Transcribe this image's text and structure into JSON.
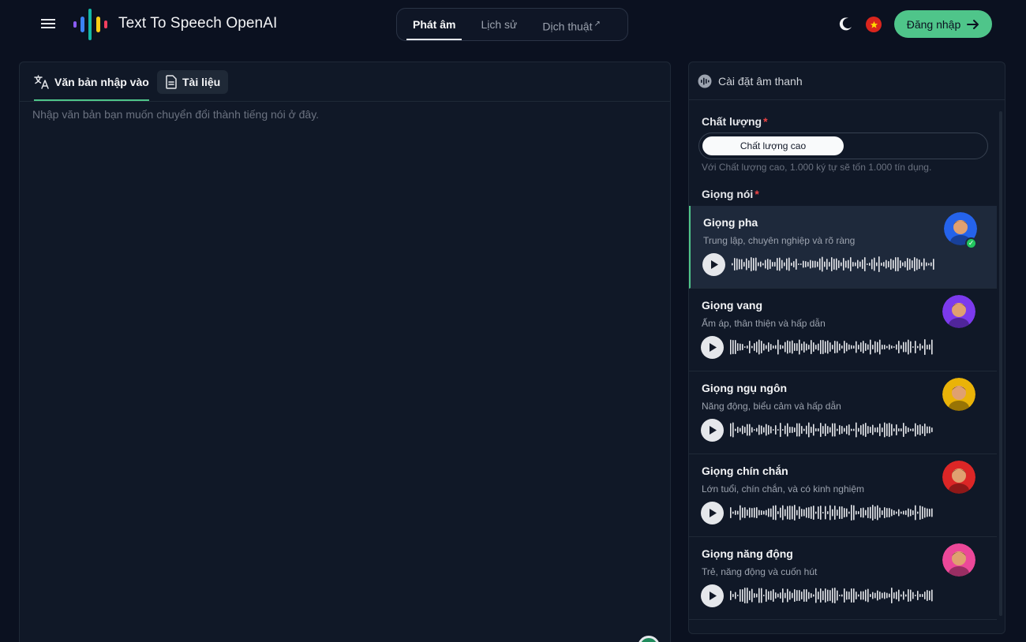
{
  "header": {
    "title": "Text To Speech OpenAI",
    "nav": [
      {
        "label": "Phát âm",
        "active": true
      },
      {
        "label": "Lịch sử",
        "active": false
      },
      {
        "label": "Dịch thuật",
        "active": false,
        "external": true
      }
    ],
    "login_label": "Đăng nhập",
    "icons": {
      "menu": "menu-icon",
      "theme": "moon-icon",
      "language": "vietnam-flag-icon",
      "login_arrow": "arrow-right-icon"
    }
  },
  "editor": {
    "tabs": [
      {
        "label": "Văn bản nhập vào",
        "icon": "translate-icon",
        "active": true
      },
      {
        "label": "Tài liệu",
        "icon": "document-icon",
        "active": false
      }
    ],
    "placeholder": "Nhập văn bản bạn muốn chuyển đổi thành tiếng nói ở đây."
  },
  "settings": {
    "title": "Cài đặt âm thanh",
    "quality_label": "Chất lượng",
    "quality_option": "Chất lượng cao",
    "quality_note": "Với Chất lượng cao, 1.000 ký tự sẽ tốn 1.000 tín dụng.",
    "voice_label": "Giọng nói",
    "voices": [
      {
        "name": "Giọng pha",
        "desc": "Trung lập, chuyên nghiệp và rõ ràng",
        "selected": true,
        "avatar_color": "#2563eb"
      },
      {
        "name": "Giọng vang",
        "desc": "Ấm áp, thân thiện và hấp dẫn",
        "selected": false,
        "avatar_color": "#7c3aed"
      },
      {
        "name": "Giọng ngụ ngôn",
        "desc": "Năng động, biểu cảm và hấp dẫn",
        "selected": false,
        "avatar_color": "#eab308"
      },
      {
        "name": "Giọng chín chắn",
        "desc": "Lớn tuổi, chín chắn, và có kinh nghiệm",
        "selected": false,
        "avatar_color": "#dc2626"
      },
      {
        "name": "Giọng năng động",
        "desc": "Trẻ, năng động và cuốn hút",
        "selected": false,
        "avatar_color": "#ec4899"
      }
    ]
  },
  "colors": {
    "accent": "#4fc58a",
    "background": "#0b1120",
    "panel": "#101827"
  }
}
